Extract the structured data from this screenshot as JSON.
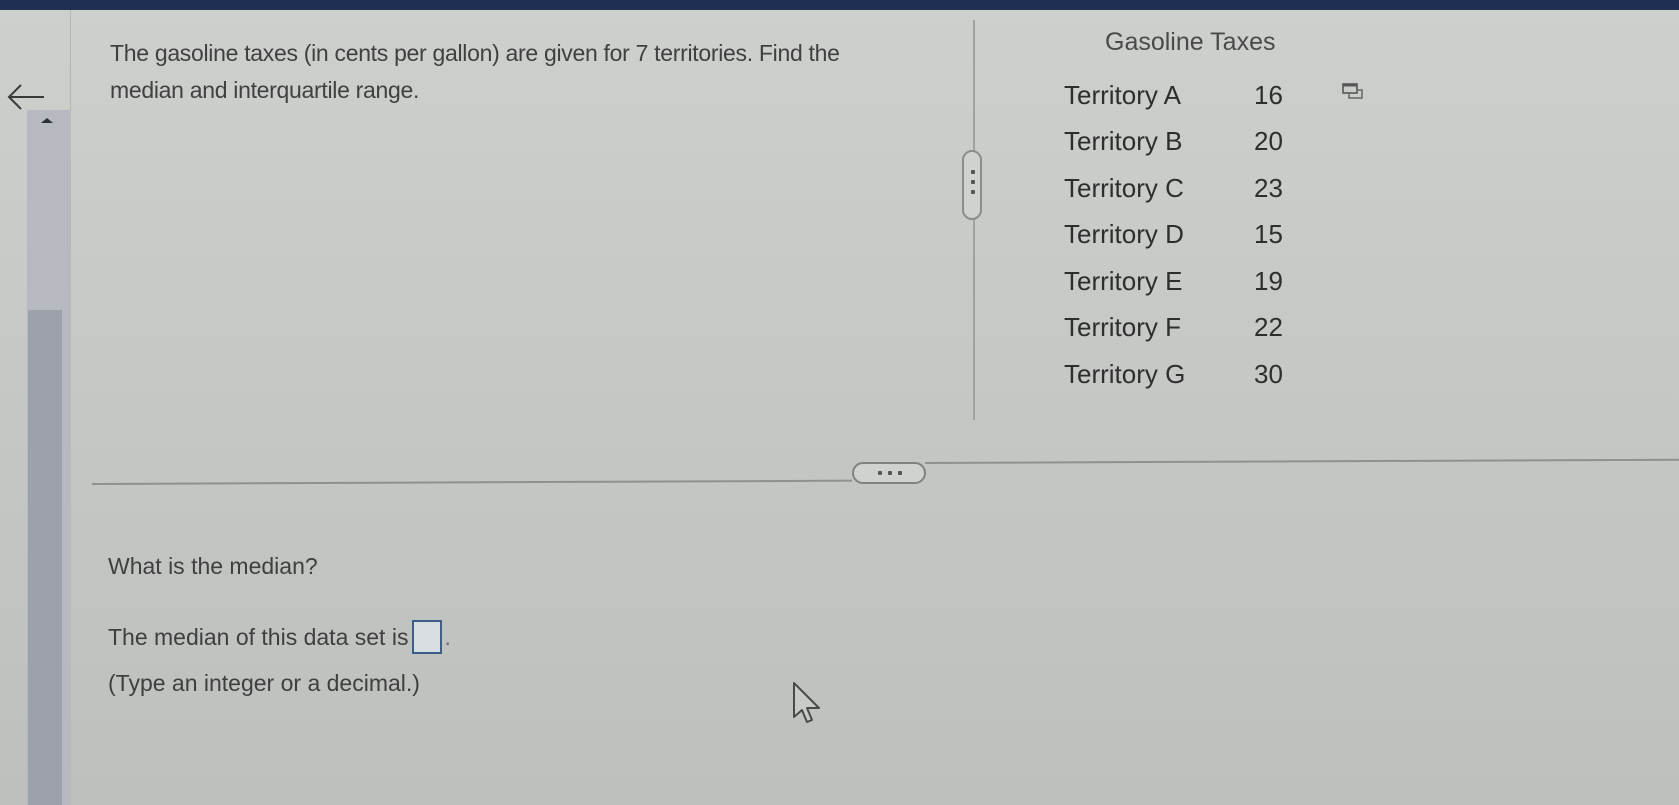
{
  "window": {
    "top_bar_color": "#1f2f52",
    "accent_input_border": "#3a5f8a"
  },
  "navigation": {
    "back_icon": "arrow-left-icon"
  },
  "question": {
    "prompt": "The gasoline taxes (in cents per gallon) are given for 7 territories. Find the median and interquartile range."
  },
  "data_table": {
    "title": "Gasoline Taxes",
    "popout_icon": "popout-window-icon",
    "rows": [
      {
        "label": "Territory A",
        "value": "16"
      },
      {
        "label": "Territory B",
        "value": "20"
      },
      {
        "label": "Territory C",
        "value": "23"
      },
      {
        "label": "Territory D",
        "value": "15"
      },
      {
        "label": "Territory E",
        "value": "19"
      },
      {
        "label": "Territory F",
        "value": "22"
      },
      {
        "label": "Territory G",
        "value": "30"
      }
    ]
  },
  "part": {
    "sub_question": "What is the median?",
    "answer_prefix": "The median of this data set is",
    "answer_value": "",
    "answer_suffix": ".",
    "hint": "(Type an integer or a decimal.)"
  }
}
